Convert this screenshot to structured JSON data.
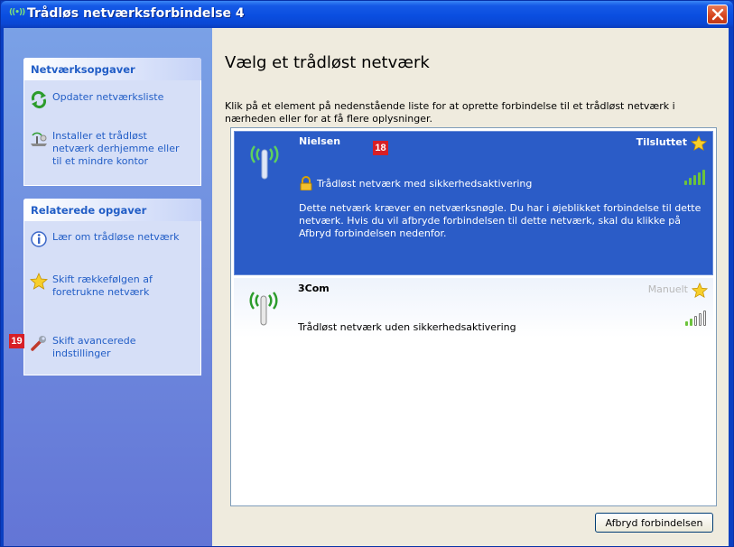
{
  "window": {
    "title": "Trådløs netværksforbindelse 4",
    "title_icon_glyph": "((•))"
  },
  "sidebar": {
    "network_tasks": {
      "heading": "Netværksopgaver",
      "items": [
        {
          "label": "Opdater netværksliste",
          "icon": "refresh-icon"
        },
        {
          "label": "Installer et trådløst\nnetværk derhjemme eller\ntil et mindre kontor",
          "icon": "wireless-setup-icon"
        }
      ]
    },
    "related_tasks": {
      "heading": "Relaterede opgaver",
      "items": [
        {
          "label": "Lær om trådløse netværk",
          "icon": "info-icon"
        },
        {
          "label": "Skift rækkefølgen af\nforetrukne netværk",
          "icon": "star-icon"
        },
        {
          "label": "Skift avancerede\nindstillinger",
          "icon": "tools-icon"
        }
      ]
    }
  },
  "badges": {
    "left": "19",
    "right": "18"
  },
  "main": {
    "title": "Vælg et trådløst netværk",
    "description": "Klik på et element på nedenstående liste for at oprette forbindelse til et trådløst netværk i nærheden eller for at få flere oplysninger.",
    "networks": [
      {
        "name": "Nielsen",
        "status": "Tilsluttet",
        "security": "Trådløst netværk med sikkerhedsaktivering",
        "detail": "Dette netværk kræver en netværksnøgle. Du har i øjeblikket forbindelse til dette netværk. Hvis du vil afbryde forbindelsen til dette netværk, skal du klikke på Afbryd forbindelsen nedenfor.",
        "signal_bars": 5
      },
      {
        "name": "3Com",
        "status": "Manuelt",
        "security": "Trådløst netværk uden sikkerhedsaktivering",
        "signal_bars": 2
      }
    ],
    "disconnect_button": "Afbryd forbindelsen"
  },
  "colors": {
    "selected": "#2b5cc7",
    "link": "#215dc6",
    "signal_green": "#6cc33c"
  }
}
